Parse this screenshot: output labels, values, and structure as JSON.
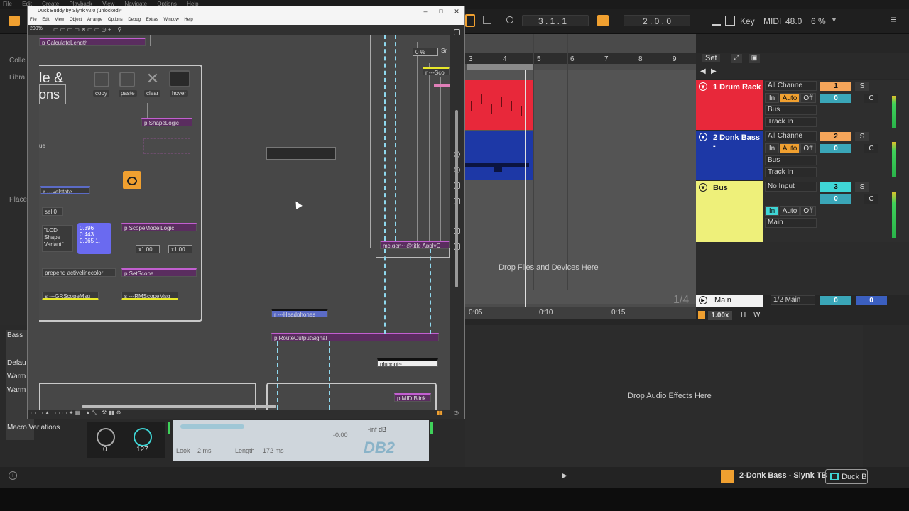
{
  "live": {
    "menu": [
      "File",
      "Edit",
      "Create",
      "Playback",
      "View",
      "Navigate",
      "Options",
      "Help"
    ],
    "position": "3 .   1 .   1",
    "loop_start": "2 .   0 .   0",
    "key_label": "Key",
    "midi_label": "MIDI",
    "tempo": "48.0",
    "cpu": "6 %",
    "set_label": "Set",
    "ruler_numbers": [
      "3",
      "4",
      "5",
      "6",
      "7",
      "8",
      "9"
    ],
    "drop_files": "Drop Files and Devices Here",
    "time_marks": [
      "0:05",
      "0:10",
      "0:15"
    ],
    "quantize": "1/4",
    "drop_audio": "Drop Audio Effects Here",
    "sidebar_labels": [
      "Colle",
      "Libra",
      "Place"
    ],
    "device_title": "Bass",
    "device_items": [
      "Defau",
      "Warm",
      "Warm"
    ],
    "macro_variations": "Macro Variations",
    "knob1_value": "0",
    "knob2_value": "127",
    "status_track": "2-Donk Bass - Slynk TB",
    "status_device": "Duck B"
  },
  "tracks": [
    {
      "name": "1 Drum Rack",
      "input": "All Channe",
      "num": "1",
      "vol": "0",
      "pan": "C",
      "color": "#e8283a",
      "num_color": "#f5a55a"
    },
    {
      "name": "2 Donk Bass -",
      "input": "All Channe",
      "num": "2",
      "vol": "0",
      "pan": "C",
      "color": "#1d38a6",
      "num_color": "#f5a55a"
    },
    {
      "name": "Bus",
      "input": "No Input",
      "num": "3",
      "vol": "0",
      "pan": "C",
      "color": "#eef07a",
      "num_color": "#3fd6d6"
    }
  ],
  "io": {
    "in": "In",
    "auto": "Auto",
    "off": "Off",
    "bus": "Bus",
    "track_in": "Track In",
    "main": "Main",
    "s": "S",
    "zoom": "1.00x",
    "h": "H",
    "w": "W"
  },
  "main_track": {
    "name": "Main",
    "output": "1/2 Main",
    "vol": "0",
    "pan": "0"
  },
  "max": {
    "title": "Duck Buddy by Slynk v2.0 (unlocked)*",
    "menu": [
      "File",
      "Edit",
      "View",
      "Object",
      "Arrange",
      "Options",
      "Debug",
      "Extras",
      "Window",
      "Help"
    ],
    "zoom": "200%",
    "objects": {
      "calc_length": "p CalculateLength",
      "shape_logic": "p ShapeLogic",
      "velstate": "r ---velstate",
      "sel": "sel 0",
      "lcd_msg": "\"LCD Shape Variant\"",
      "values": [
        "0.396",
        "0.443",
        "0.965 1."
      ],
      "scope_model": "p ScopeModelLogic",
      "mult1": "x1.00",
      "mult2": "x1.00",
      "prepend": "prepend activelinecolor",
      "set_scope": "p SetScope",
      "gr_scope": "s ---GRScopeMsg",
      "rm_scope": "s ---RMScopeMsg",
      "headphones": "r ---Headphones",
      "route_output": "p RouteOutputSignal",
      "mc_gen": "mc.gen~ @title ApplyC",
      "plugout": "plugout~",
      "midiblink": "p MIDIBlink",
      "percent": "0 %",
      "sc_label": "Sr",
      "r_sco": "r ---Sco",
      "ue": "ue",
      "big_text_1": "le &",
      "big_text_2": "ons"
    },
    "buttons": [
      "copy",
      "paste",
      "clear",
      "hover"
    ]
  },
  "plugin_strip": {
    "look_label": "Look",
    "look_value": "2 ms",
    "length_label": "Length",
    "length_value": "172 ms",
    "gain": "-0.00",
    "db_readout": "-inf dB",
    "logo": "DB2"
  }
}
